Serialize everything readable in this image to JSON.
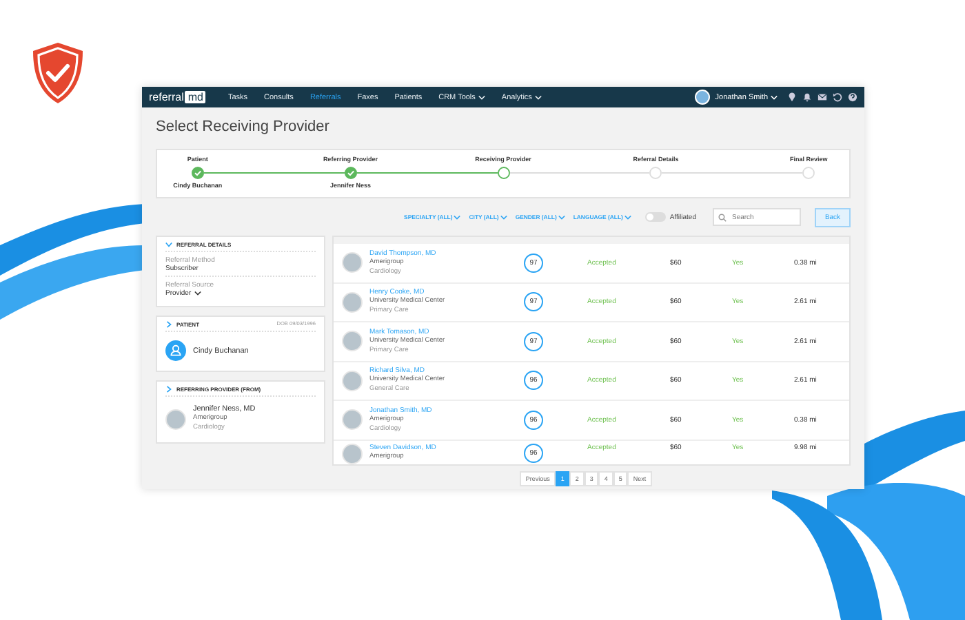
{
  "nav": {
    "brand_main": "referral",
    "brand_accent": "md",
    "items": [
      {
        "label": "Tasks",
        "selected": false,
        "dropdown": false
      },
      {
        "label": "Consults",
        "selected": false,
        "dropdown": false
      },
      {
        "label": "Referrals",
        "selected": true,
        "dropdown": false
      },
      {
        "label": "Faxes",
        "selected": false,
        "dropdown": false
      },
      {
        "label": "Patients",
        "selected": false,
        "dropdown": false
      },
      {
        "label": "CRM Tools",
        "selected": false,
        "dropdown": true
      },
      {
        "label": "Analytics",
        "selected": false,
        "dropdown": true
      }
    ],
    "user": "Jonathan Smith"
  },
  "page_title": "Select Receiving Provider",
  "steps": [
    {
      "label": "Patient",
      "value": "Cindy Buchanan",
      "completed": true,
      "selected": false
    },
    {
      "label": "Referring Provider",
      "value": "Jennifer Ness",
      "completed": true,
      "selected": false
    },
    {
      "label": "Receiving Provider",
      "completed": false,
      "selected": true
    },
    {
      "label": "Referral Details",
      "completed": false,
      "selected": false
    },
    {
      "label": "Final Review",
      "completed": false,
      "selected": false
    }
  ],
  "filters": [
    "SPECIALTY (ALL)",
    "CITY (ALL)",
    "GENDER (ALL)",
    "LANGUAGE (ALL)"
  ],
  "affiliated": {
    "label": "Affiliated",
    "on": false
  },
  "search": {
    "placeholder": "Search"
  },
  "back_button": "Back",
  "referral_details": {
    "title": "REFERRAL DETAILS",
    "expanded": true,
    "fields": [
      {
        "label": "Referral Method",
        "value": "Subscriber",
        "dropdown": false
      },
      {
        "label": "Referral Source",
        "value": "Provider",
        "dropdown": true
      }
    ]
  },
  "patient": {
    "title": "PATIENT",
    "expanded": false,
    "dob": "DOB 09/03/1996",
    "name": "Cindy Buchanan"
  },
  "referring_provider": {
    "title": "REFERRING PROVIDER (FROM)",
    "expanded": false,
    "name": "Jennifer Ness, MD",
    "org": "Amerigroup",
    "specialty": "Cardiology"
  },
  "providers": [
    {
      "name": "David Thompson, MD",
      "org": "Amerigroup",
      "specialty": "Cardiology",
      "score": "97",
      "status": "Accepted",
      "price": "$60",
      "affiliated": "Yes",
      "distance": "0.38 mi"
    },
    {
      "name": "Henry Cooke, MD",
      "org": "University Medical Center",
      "specialty": "Primary Care",
      "score": "97",
      "status": "Accepted",
      "price": "$60",
      "affiliated": "Yes",
      "distance": "2.61 mi"
    },
    {
      "name": "Mark Tomason, MD",
      "org": "University Medical Center",
      "specialty": "Primary Care",
      "score": "97",
      "status": "Accepted",
      "price": "$60",
      "affiliated": "Yes",
      "distance": "2.61 mi"
    },
    {
      "name": "Richard Silva, MD",
      "org": "University Medical Center",
      "specialty": "General Care",
      "score": "96",
      "status": "Accepted",
      "price": "$60",
      "affiliated": "Yes",
      "distance": "2.61 mi"
    },
    {
      "name": "Jonathan Smith, MD",
      "org": "Amerigroup",
      "specialty": "Cardiology",
      "score": "96",
      "status": "Accepted",
      "price": "$60",
      "affiliated": "Yes",
      "distance": "0.38 mi"
    },
    {
      "name": "Steven Davidson, MD",
      "org": "Amerigroup",
      "score": "96",
      "status": "Accepted",
      "price": "$60",
      "affiliated": "Yes",
      "distance": "9.98 mi"
    }
  ],
  "pagination": {
    "previous": "Previous",
    "next": "Next",
    "pages": [
      {
        "label": "1",
        "selected": true
      },
      {
        "label": "2",
        "selected": false
      },
      {
        "label": "3",
        "selected": false
      },
      {
        "label": "4",
        "selected": false
      },
      {
        "label": "5",
        "selected": false
      }
    ]
  }
}
